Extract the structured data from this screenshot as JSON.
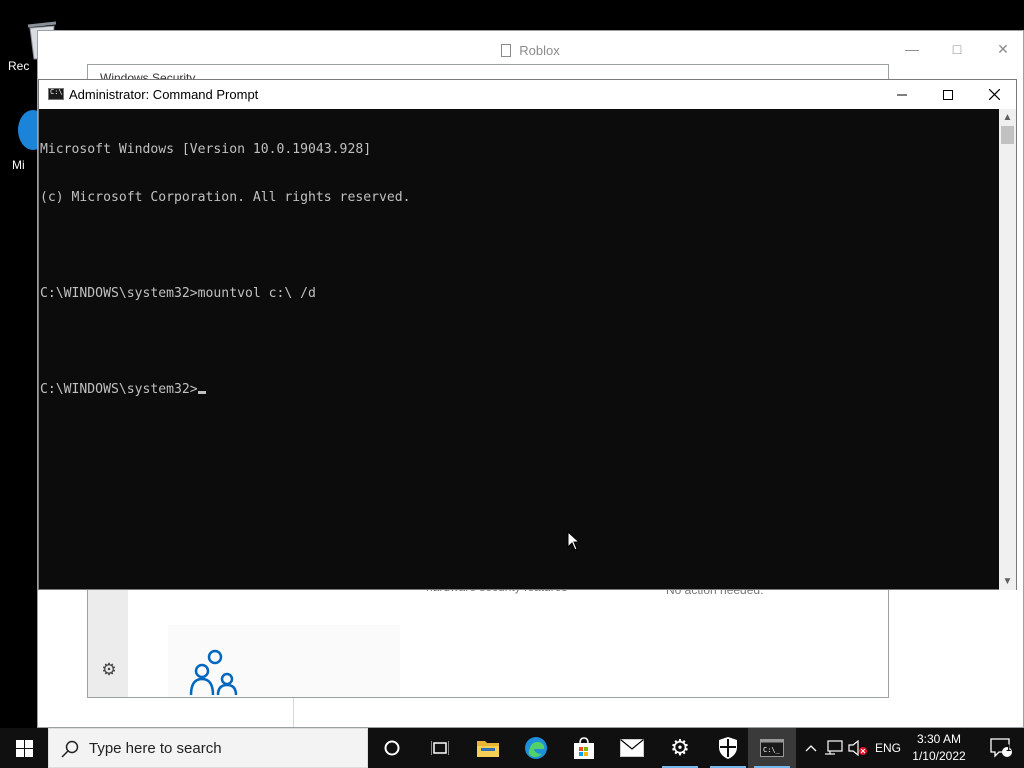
{
  "desktop": {
    "icons": [
      {
        "label": "Rec",
        "icon": "recycle-bin-icon"
      },
      {
        "label": "Mi",
        "icon": "edge-desktop-icon"
      }
    ]
  },
  "roblox_window": {
    "title": "Roblox"
  },
  "security_window": {
    "title": "Windows Security",
    "line1": "hardware security features",
    "line2": "No action needed."
  },
  "cmd_window": {
    "title": "Administrator: Command Prompt",
    "lines": [
      "Microsoft Windows [Version 10.0.19043.928]",
      "(c) Microsoft Corporation. All rights reserved.",
      "",
      "C:\\WINDOWS\\system32>mountvol c:\\ /d",
      "",
      "C:\\WINDOWS\\system32>"
    ],
    "text_color": "#c0c0c0",
    "background": "#0c0c0c"
  },
  "taskbar": {
    "search_placeholder": "Type here to search",
    "apps": [
      {
        "name": "cortana",
        "icon": "circle-icon"
      },
      {
        "name": "task-view",
        "icon": "task-view-icon"
      },
      {
        "name": "file-explorer",
        "icon": "folder-icon"
      },
      {
        "name": "edge",
        "icon": "edge-icon"
      },
      {
        "name": "store",
        "icon": "store-icon"
      },
      {
        "name": "mail",
        "icon": "mail-icon"
      },
      {
        "name": "settings",
        "icon": "gear-icon"
      },
      {
        "name": "security",
        "icon": "shield-icon"
      },
      {
        "name": "command-prompt",
        "icon": "terminal-icon",
        "active": true
      }
    ],
    "language": "ENG",
    "time": "3:30 AM",
    "date": "1/10/2022",
    "notification_count": "1"
  }
}
